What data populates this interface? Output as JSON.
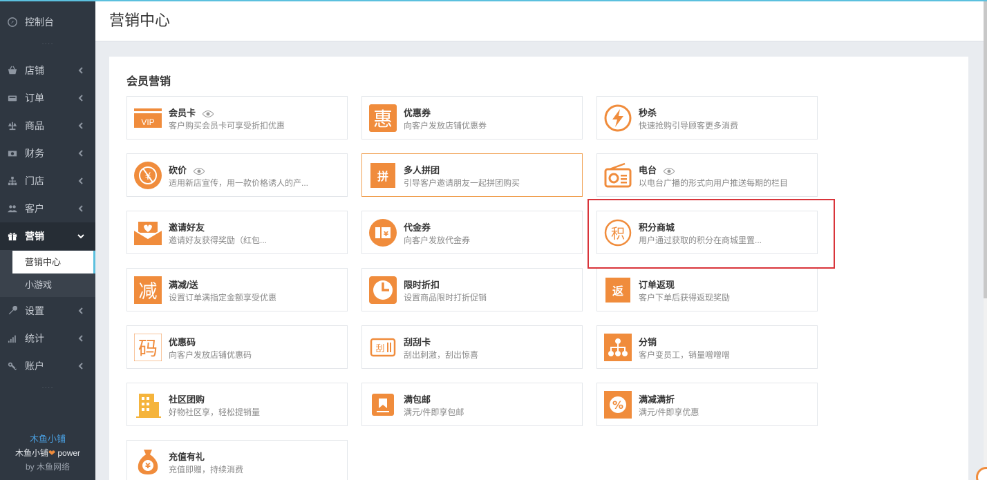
{
  "sidebar": {
    "items": [
      {
        "label": "控制台",
        "icon": "dashboard-icon"
      },
      {
        "label": "店铺",
        "icon": "shop-basket-icon"
      },
      {
        "label": "订单",
        "icon": "order-icon"
      },
      {
        "label": "商品",
        "icon": "scale-icon"
      },
      {
        "label": "财务",
        "icon": "money-icon"
      },
      {
        "label": "门店",
        "icon": "sitemap-icon"
      },
      {
        "label": "客户",
        "icon": "users-icon"
      },
      {
        "label": "营销",
        "icon": "gift-icon"
      },
      {
        "label": "设置",
        "icon": "wrench-icon"
      },
      {
        "label": "统计",
        "icon": "signal-icon"
      },
      {
        "label": "账户",
        "icon": "key-icon"
      }
    ],
    "sub_items": [
      "营销中心",
      "小游戏"
    ],
    "dots": "····",
    "brand": {
      "name": "木鱼小铺",
      "power_prefix": "木鱼小铺",
      "heart": "❤",
      "power_suffix": " power",
      "by": "by 木鱼网络"
    }
  },
  "header": {
    "title": "营销中心"
  },
  "section": {
    "title": "会员营销"
  },
  "colors": {
    "accent": "#f08c3c",
    "sidebar_bg": "#2f3741",
    "highlight_border": "#d9343a"
  },
  "cards": [
    {
      "name": "会员卡",
      "desc": "客户购买会员卡可享受折扣优惠",
      "icon": "vip-icon",
      "eye": true
    },
    {
      "name": "优惠券",
      "desc": "向客户发放店铺优惠券",
      "icon": "hui-coupon-icon"
    },
    {
      "name": "秒杀",
      "desc": "快速抢购引导顾客更多消费",
      "icon": "lightning-icon"
    },
    {
      "name": "砍价",
      "desc": "适用新店宣传，用一款价格诱人的产...",
      "icon": "bargain-icon",
      "eye": true
    },
    {
      "name": "多人拼团",
      "desc": "引导客户邀请朋友一起拼团购买",
      "icon": "pin-group-icon"
    },
    {
      "name": "电台",
      "desc": "以电台广播的形式向用户推送每期的栏目",
      "icon": "radio-icon",
      "eye": true
    },
    {
      "name": "邀请好友",
      "desc": "邀请好友获得奖励（红包...",
      "icon": "invite-envelope-icon"
    },
    {
      "name": "代金券",
      "desc": "向客户发放代金券",
      "icon": "voucher-icon"
    },
    {
      "name": "积分商城",
      "desc": "用户通过获取的积分在商城里置...",
      "icon": "points-mall-icon"
    },
    {
      "name": "满减/送",
      "desc": "设置订单满指定金额享受优惠",
      "icon": "jian-reduce-icon"
    },
    {
      "name": "限时折扣",
      "desc": "设置商品限时打折促销",
      "icon": "clock-icon"
    },
    {
      "name": "订单返现",
      "desc": "客户下单后获得返现奖励",
      "icon": "fan-cashback-icon"
    },
    {
      "name": "优惠码",
      "desc": "向客户发放店铺优惠码",
      "icon": "ma-code-icon"
    },
    {
      "name": "刮刮卡",
      "desc": "刮出刺激，刮出惊喜",
      "icon": "scratch-card-icon"
    },
    {
      "name": "分销",
      "desc": "客户变员工，销量噌噌噌",
      "icon": "distribution-icon"
    },
    {
      "name": "社区团购",
      "desc": "好物社区享，轻松提销量",
      "icon": "building-icon"
    },
    {
      "name": "满包邮",
      "desc": "满元/件即享包邮",
      "icon": "package-icon"
    },
    {
      "name": "满减满折",
      "desc": "满元/件即享优惠",
      "icon": "percent-icon"
    },
    {
      "name": "充值有礼",
      "desc": "充值即赠，持续消费",
      "icon": "money-bag-icon"
    }
  ],
  "icon_glyphs": {
    "vip": "VIP",
    "hui": "惠",
    "pin": "拼",
    "jian": "减",
    "fan": "返",
    "ma": "码",
    "ji": "积",
    "gua": "刮",
    "yen": "¥",
    "percent": "%"
  }
}
